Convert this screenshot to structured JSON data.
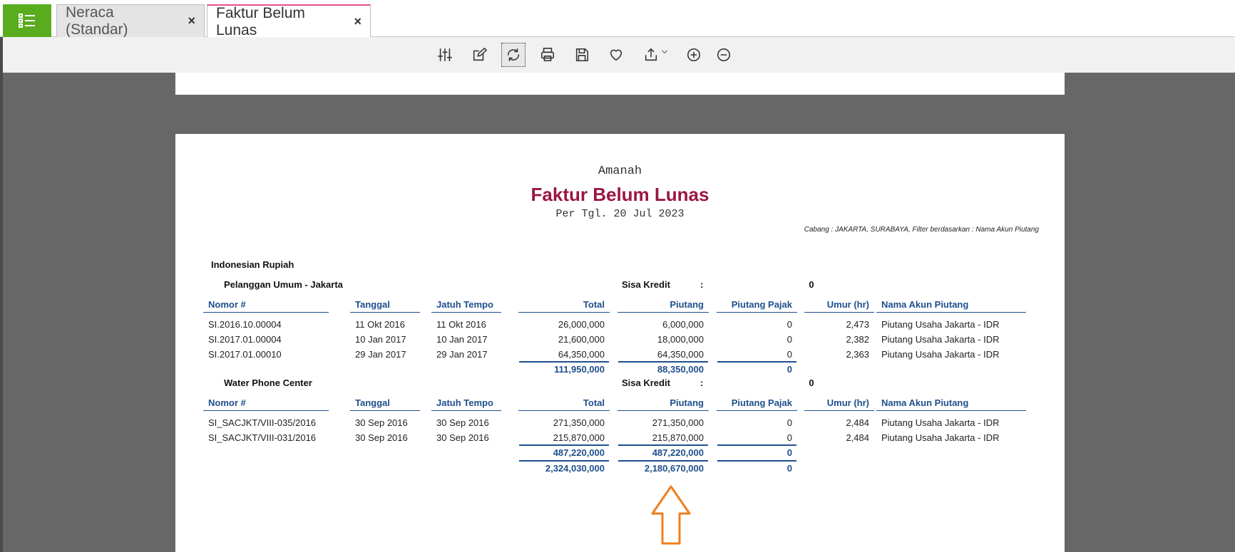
{
  "tabs": {
    "tab1": {
      "label": "Neraca (Standar)",
      "close": "×"
    },
    "tab2": {
      "label": "Faktur Belum Lunas",
      "close": "×"
    }
  },
  "toolbar": {
    "icons": [
      "sliders-icon",
      "edit-icon",
      "refresh-icon",
      "print-icon",
      "save-icon",
      "heart-icon",
      "export-icon",
      "zoom-in-icon",
      "zoom-out-icon"
    ]
  },
  "report": {
    "company": "Amanah",
    "title": "Faktur Belum Lunas",
    "date": "Per Tgl. 20 Jul 2023",
    "filter": "Cabang : JAKARTA, SURABAYA, Filter berdasarkan : Nama Akun Piutang",
    "currency": "Indonesian Rupiah",
    "headers": [
      "Nomor #",
      "Tanggal",
      "Jatuh Tempo",
      "Total",
      "Piutang",
      "Piutang Pajak",
      "Umur (hr)",
      "Nama Akun Piutang"
    ],
    "sisa_label": "Sisa Kredit",
    "colon": ":",
    "customers": [
      {
        "name": "Pelanggan Umum - Jakarta",
        "sisa_kredit": "0",
        "rows": [
          [
            "SI.2016.10.00004",
            "11 Okt 2016",
            "11 Okt 2016",
            "26,000,000",
            "6,000,000",
            "0",
            "2,473",
            "Piutang Usaha Jakarta - IDR"
          ],
          [
            "SI.2017.01.00004",
            "10 Jan 2017",
            "10 Jan 2017",
            "21,600,000",
            "18,000,000",
            "0",
            "2,382",
            "Piutang Usaha Jakarta - IDR"
          ],
          [
            "SI.2017.01.00010",
            "29 Jan 2017",
            "29 Jan 2017",
            "64,350,000",
            "64,350,000",
            "0",
            "2,363",
            "Piutang Usaha Jakarta - IDR"
          ]
        ],
        "subtotal": {
          "total": "111,950,000",
          "piutang": "88,350,000",
          "pajak": "0"
        }
      },
      {
        "name": "Water Phone Center",
        "sisa_kredit": "0",
        "rows": [
          [
            "SI_SACJKT/VIII-035/2016",
            "30 Sep 2016",
            "30 Sep 2016",
            "271,350,000",
            "271,350,000",
            "0",
            "2,484",
            "Piutang Usaha Jakarta - IDR"
          ],
          [
            "SI_SACJKT/VIII-031/2016",
            "30 Sep 2016",
            "30 Sep 2016",
            "215,870,000",
            "215,870,000",
            "0",
            "2,484",
            "Piutang Usaha Jakarta - IDR"
          ]
        ],
        "subtotal": {
          "total": "487,220,000",
          "piutang": "487,220,000",
          "pajak": "0"
        }
      }
    ],
    "grand_total": {
      "total": "2,324,030,000",
      "piutang": "2,180,670,000",
      "pajak": "0"
    }
  },
  "colors": {
    "accent": "#e7508f",
    "menu": "#5aac1f",
    "title": "#9b1642",
    "header": "#1e4f8c",
    "arrow": "#f07f1b"
  }
}
